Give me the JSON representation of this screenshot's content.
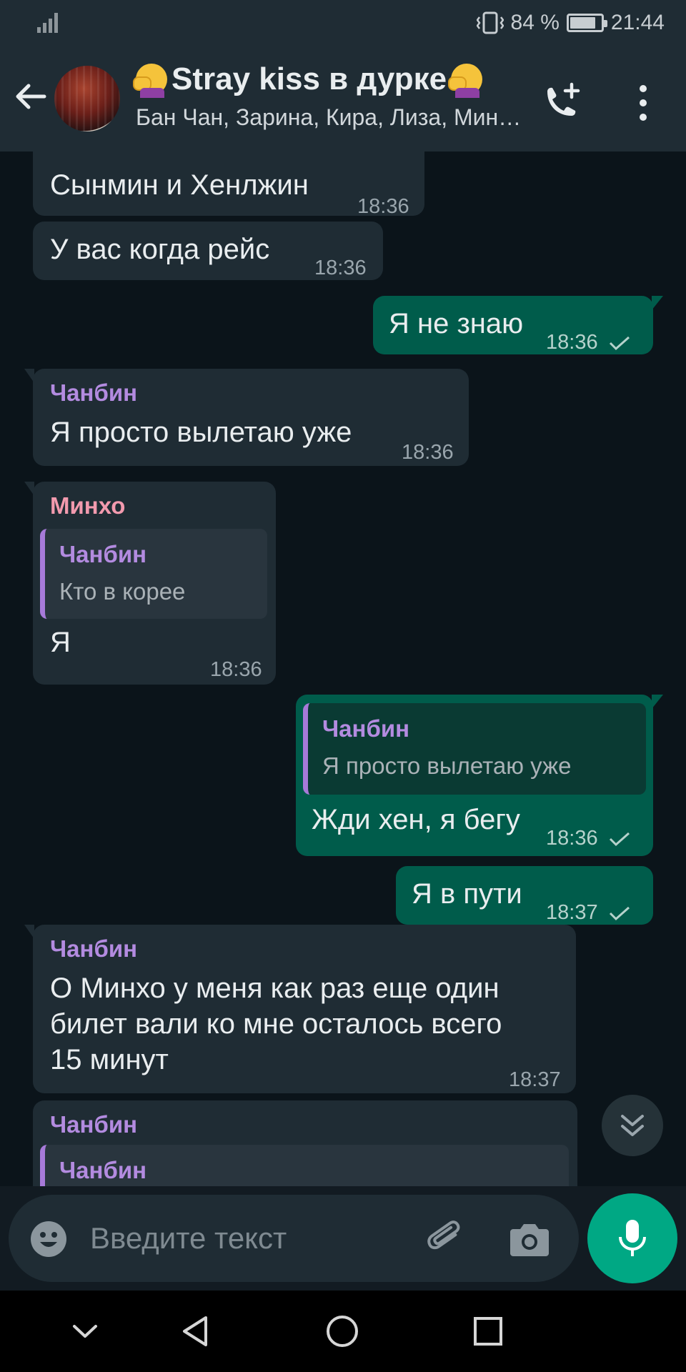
{
  "status_bar": {
    "battery_percent": "84 %",
    "battery_level": 0.84,
    "clock": "21:44"
  },
  "header": {
    "title": "Stray kiss в дурке",
    "participants": "Бан Чан, Зарина, Кира, Лиза, Минхо...",
    "icons": [
      "back-arrow-icon",
      "add-call-icon",
      "more-vert-icon"
    ]
  },
  "messages": [
    {
      "type": "incoming",
      "text": "Сынмин и Хенлжин",
      "time": "18:36"
    },
    {
      "type": "incoming",
      "text": "У вас когда рейс",
      "time": "18:36"
    },
    {
      "type": "outgoing",
      "text": "Я не знаю",
      "time": "18:36"
    },
    {
      "type": "incoming",
      "sender": "Чанбин",
      "text": "Я просто вылетаю уже",
      "time": "18:36"
    },
    {
      "type": "incoming",
      "sender": "Минхо",
      "quote_sender": "Чанбин",
      "quote_text": "Кто в корее",
      "text": "Я",
      "time": "18:36"
    },
    {
      "type": "outgoing",
      "quote_sender": "Чанбин",
      "quote_text": "Я просто вылетаю уже",
      "text": "Жди хен, я бегу",
      "time": "18:36"
    },
    {
      "type": "outgoing",
      "text": "Я в пути",
      "time": "18:37"
    },
    {
      "type": "incoming",
      "sender": "Чанбин",
      "text_lines": [
        "О Минхо у меня как раз еще один",
        "билет вали ко мне осталось всего",
        "15 минут"
      ],
      "time": "18:37"
    },
    {
      "type": "incoming",
      "sender": "Чанбин",
      "quote_sender": "Чанбин"
    }
  ],
  "composer": {
    "placeholder": "Введите текст",
    "icons": [
      "emoji-icon",
      "attach-icon",
      "camera-icon",
      "mic-icon"
    ]
  },
  "colors": {
    "accent": "#00a884",
    "outgoing_bubble": "#005c4b",
    "incoming_bubble": "#1f2c34",
    "sender_purple": "#b38be0",
    "sender_pink": "#f29aae"
  }
}
